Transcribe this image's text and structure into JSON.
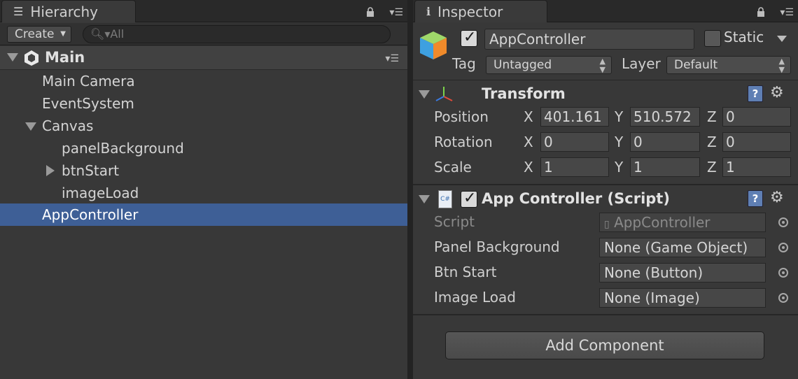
{
  "hierarchy": {
    "tab_title": "Hierarchy",
    "create_label": "Create",
    "search_placeholder": "All",
    "scene_name": "Main",
    "items": [
      {
        "label": "Main Camera"
      },
      {
        "label": "EventSystem"
      },
      {
        "label": "Canvas"
      },
      {
        "label": "panelBackground"
      },
      {
        "label": "btnStart"
      },
      {
        "label": "imageLoad"
      },
      {
        "label": "AppController"
      }
    ],
    "selected_item": "AppController"
  },
  "inspector": {
    "tab_title": "Inspector",
    "object_name": "AppController",
    "active": true,
    "static_label": "Static",
    "static_checked": false,
    "tag_label": "Tag",
    "tag_value": "Untagged",
    "layer_label": "Layer",
    "layer_value": "Default",
    "transform": {
      "title": "Transform",
      "rows": [
        {
          "label": "Position",
          "x": "401.161",
          "y": "510.572",
          "z": "0"
        },
        {
          "label": "Rotation",
          "x": "0",
          "y": "0",
          "z": "0"
        },
        {
          "label": "Scale",
          "x": "1",
          "y": "1",
          "z": "1"
        }
      ],
      "axis_x": "X",
      "axis_y": "Y",
      "axis_z": "Z"
    },
    "script_component": {
      "title": "App Controller (Script)",
      "enabled": true,
      "icon_text": "C#",
      "fields": [
        {
          "label": "Script",
          "value": "AppController"
        },
        {
          "label": "Panel Background",
          "value": "None (Game Object)"
        },
        {
          "label": "Btn Start",
          "value": "None (Button)"
        },
        {
          "label": "Image Load",
          "value": "None (Image)"
        }
      ]
    },
    "add_component_label": "Add Component"
  },
  "colors": {
    "selection": "#3e5f96",
    "panel_bg": "#383838",
    "help_icon": "#5f7fb4"
  },
  "icons": [
    "hierarchy-list-icon",
    "info-icon",
    "lock-icon",
    "menu-icon",
    "unity-icon",
    "cube-icon",
    "transform-axes-icon",
    "csharp-script-icon",
    "help-icon",
    "gear-icon",
    "object-picker-icon",
    "search-icon"
  ]
}
